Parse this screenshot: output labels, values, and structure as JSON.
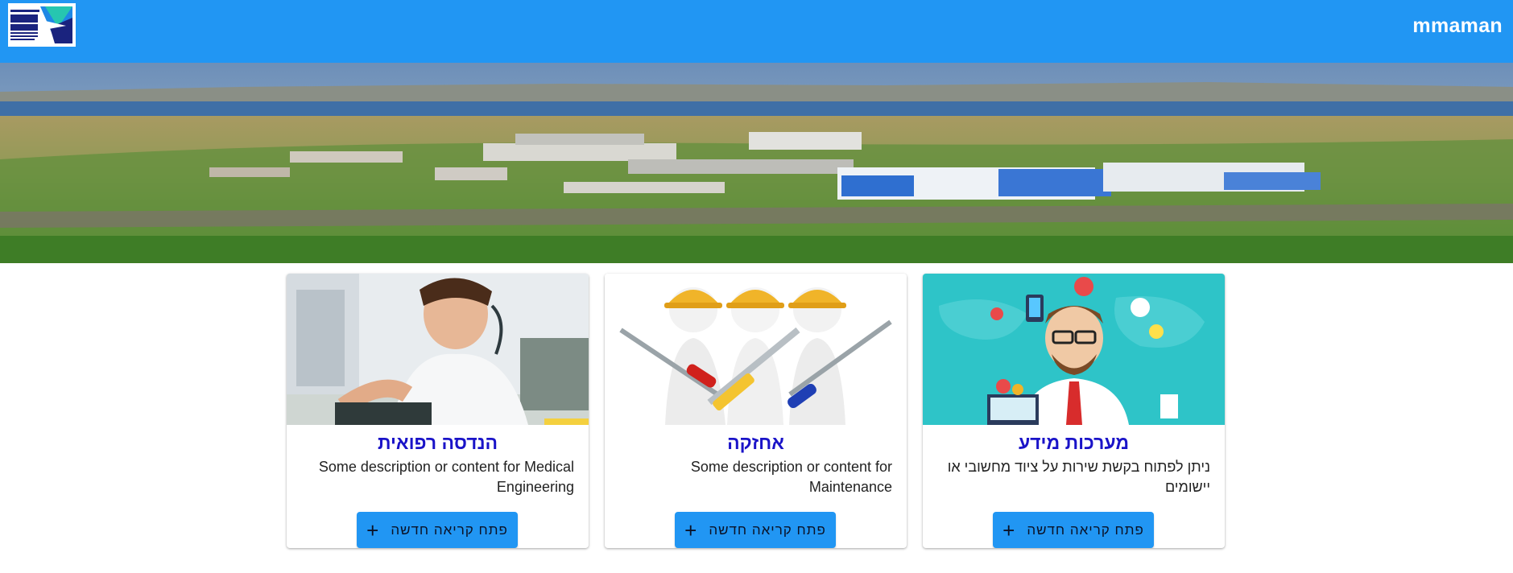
{
  "header": {
    "logo_text": "מרכז רפואי צפון",
    "username": "mmaman",
    "background_color": "#2196f3"
  },
  "hero": {
    "image_semantic": "hospital-aerial-photo"
  },
  "cards": [
    {
      "title": "מערכות מידע",
      "description": "ניתן לפתוח בקשת שירות על ציוד מחשובי או יישומים",
      "button_label": "פתח קריאה חדשה",
      "image_semantic": "it-support-illustration"
    },
    {
      "title": "אחזקה",
      "description": "Some description or content for Maintenance",
      "button_label": "פתח קריאה חדשה",
      "image_semantic": "maintenance-workers-illustration"
    },
    {
      "title": "הנדסה רפואית",
      "description": "Some description or content for Medical Engineering",
      "button_label": "פתח קריאה חדשה",
      "image_semantic": "medical-engineer-photo"
    }
  ],
  "colors": {
    "accent": "#2196f3",
    "title": "#1a13c8"
  }
}
